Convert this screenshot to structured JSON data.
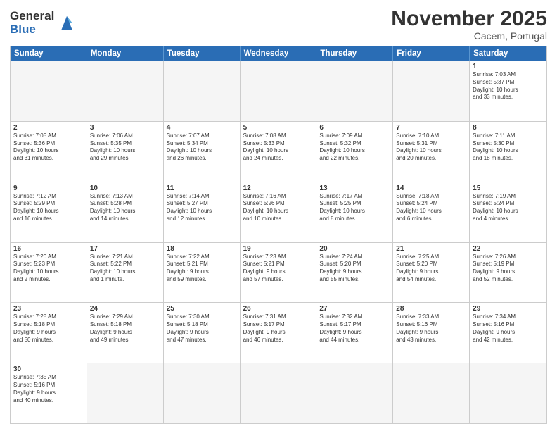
{
  "header": {
    "logo_general": "General",
    "logo_blue": "Blue",
    "month_title": "November 2025",
    "location": "Cacem, Portugal"
  },
  "weekdays": [
    "Sunday",
    "Monday",
    "Tuesday",
    "Wednesday",
    "Thursday",
    "Friday",
    "Saturday"
  ],
  "rows": [
    [
      {
        "day": "",
        "text": "",
        "empty": true
      },
      {
        "day": "",
        "text": "",
        "empty": true
      },
      {
        "day": "",
        "text": "",
        "empty": true
      },
      {
        "day": "",
        "text": "",
        "empty": true
      },
      {
        "day": "",
        "text": "",
        "empty": true
      },
      {
        "day": "",
        "text": "",
        "empty": true
      },
      {
        "day": "1",
        "text": "Sunrise: 7:03 AM\nSunset: 5:37 PM\nDaylight: 10 hours\nand 33 minutes.",
        "empty": false
      }
    ],
    [
      {
        "day": "2",
        "text": "Sunrise: 7:05 AM\nSunset: 5:36 PM\nDaylight: 10 hours\nand 31 minutes.",
        "empty": false
      },
      {
        "day": "3",
        "text": "Sunrise: 7:06 AM\nSunset: 5:35 PM\nDaylight: 10 hours\nand 29 minutes.",
        "empty": false
      },
      {
        "day": "4",
        "text": "Sunrise: 7:07 AM\nSunset: 5:34 PM\nDaylight: 10 hours\nand 26 minutes.",
        "empty": false
      },
      {
        "day": "5",
        "text": "Sunrise: 7:08 AM\nSunset: 5:33 PM\nDaylight: 10 hours\nand 24 minutes.",
        "empty": false
      },
      {
        "day": "6",
        "text": "Sunrise: 7:09 AM\nSunset: 5:32 PM\nDaylight: 10 hours\nand 22 minutes.",
        "empty": false
      },
      {
        "day": "7",
        "text": "Sunrise: 7:10 AM\nSunset: 5:31 PM\nDaylight: 10 hours\nand 20 minutes.",
        "empty": false
      },
      {
        "day": "8",
        "text": "Sunrise: 7:11 AM\nSunset: 5:30 PM\nDaylight: 10 hours\nand 18 minutes.",
        "empty": false
      }
    ],
    [
      {
        "day": "9",
        "text": "Sunrise: 7:12 AM\nSunset: 5:29 PM\nDaylight: 10 hours\nand 16 minutes.",
        "empty": false
      },
      {
        "day": "10",
        "text": "Sunrise: 7:13 AM\nSunset: 5:28 PM\nDaylight: 10 hours\nand 14 minutes.",
        "empty": false
      },
      {
        "day": "11",
        "text": "Sunrise: 7:14 AM\nSunset: 5:27 PM\nDaylight: 10 hours\nand 12 minutes.",
        "empty": false
      },
      {
        "day": "12",
        "text": "Sunrise: 7:16 AM\nSunset: 5:26 PM\nDaylight: 10 hours\nand 10 minutes.",
        "empty": false
      },
      {
        "day": "13",
        "text": "Sunrise: 7:17 AM\nSunset: 5:25 PM\nDaylight: 10 hours\nand 8 minutes.",
        "empty": false
      },
      {
        "day": "14",
        "text": "Sunrise: 7:18 AM\nSunset: 5:24 PM\nDaylight: 10 hours\nand 6 minutes.",
        "empty": false
      },
      {
        "day": "15",
        "text": "Sunrise: 7:19 AM\nSunset: 5:24 PM\nDaylight: 10 hours\nand 4 minutes.",
        "empty": false
      }
    ],
    [
      {
        "day": "16",
        "text": "Sunrise: 7:20 AM\nSunset: 5:23 PM\nDaylight: 10 hours\nand 2 minutes.",
        "empty": false
      },
      {
        "day": "17",
        "text": "Sunrise: 7:21 AM\nSunset: 5:22 PM\nDaylight: 10 hours\nand 1 minute.",
        "empty": false
      },
      {
        "day": "18",
        "text": "Sunrise: 7:22 AM\nSunset: 5:21 PM\nDaylight: 9 hours\nand 59 minutes.",
        "empty": false
      },
      {
        "day": "19",
        "text": "Sunrise: 7:23 AM\nSunset: 5:21 PM\nDaylight: 9 hours\nand 57 minutes.",
        "empty": false
      },
      {
        "day": "20",
        "text": "Sunrise: 7:24 AM\nSunset: 5:20 PM\nDaylight: 9 hours\nand 55 minutes.",
        "empty": false
      },
      {
        "day": "21",
        "text": "Sunrise: 7:25 AM\nSunset: 5:20 PM\nDaylight: 9 hours\nand 54 minutes.",
        "empty": false
      },
      {
        "day": "22",
        "text": "Sunrise: 7:26 AM\nSunset: 5:19 PM\nDaylight: 9 hours\nand 52 minutes.",
        "empty": false
      }
    ],
    [
      {
        "day": "23",
        "text": "Sunrise: 7:28 AM\nSunset: 5:18 PM\nDaylight: 9 hours\nand 50 minutes.",
        "empty": false
      },
      {
        "day": "24",
        "text": "Sunrise: 7:29 AM\nSunset: 5:18 PM\nDaylight: 9 hours\nand 49 minutes.",
        "empty": false
      },
      {
        "day": "25",
        "text": "Sunrise: 7:30 AM\nSunset: 5:18 PM\nDaylight: 9 hours\nand 47 minutes.",
        "empty": false
      },
      {
        "day": "26",
        "text": "Sunrise: 7:31 AM\nSunset: 5:17 PM\nDaylight: 9 hours\nand 46 minutes.",
        "empty": false
      },
      {
        "day": "27",
        "text": "Sunrise: 7:32 AM\nSunset: 5:17 PM\nDaylight: 9 hours\nand 44 minutes.",
        "empty": false
      },
      {
        "day": "28",
        "text": "Sunrise: 7:33 AM\nSunset: 5:16 PM\nDaylight: 9 hours\nand 43 minutes.",
        "empty": false
      },
      {
        "day": "29",
        "text": "Sunrise: 7:34 AM\nSunset: 5:16 PM\nDaylight: 9 hours\nand 42 minutes.",
        "empty": false
      }
    ],
    [
      {
        "day": "30",
        "text": "Sunrise: 7:35 AM\nSunset: 5:16 PM\nDaylight: 9 hours\nand 40 minutes.",
        "empty": false
      },
      {
        "day": "",
        "text": "",
        "empty": true
      },
      {
        "day": "",
        "text": "",
        "empty": true
      },
      {
        "day": "",
        "text": "",
        "empty": true
      },
      {
        "day": "",
        "text": "",
        "empty": true
      },
      {
        "day": "",
        "text": "",
        "empty": true
      },
      {
        "day": "",
        "text": "",
        "empty": true
      }
    ]
  ]
}
